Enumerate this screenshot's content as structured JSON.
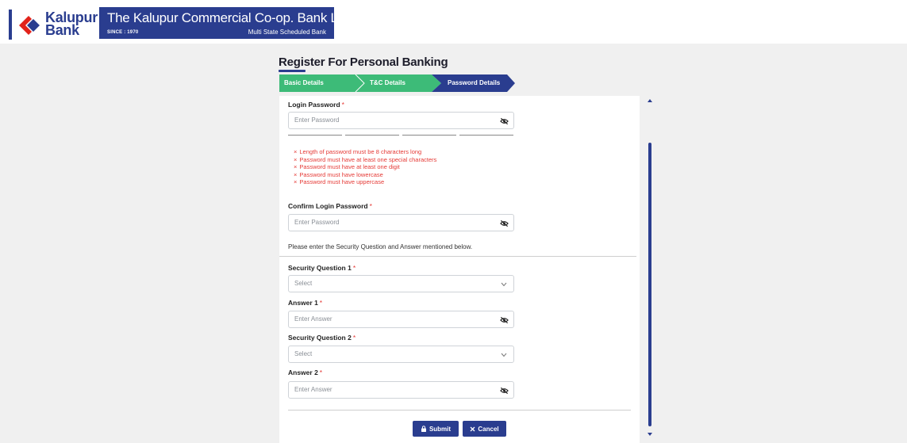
{
  "header": {
    "logo_name": "Kalupur\nBank",
    "logo_line1": "Kalupur",
    "logo_line2": "Bank",
    "bank_title": "The Kalupur Commercial Co-op. Bank Ltd.",
    "since": "SINCE : 1970",
    "tagline": "Multi State Scheduled Bank"
  },
  "page": {
    "heading": "Register For Personal Banking"
  },
  "stepper": {
    "steps": [
      {
        "label": "Basic Details",
        "state": "complete"
      },
      {
        "label": "T&C Details",
        "state": "complete"
      },
      {
        "label": "Password Details",
        "state": "active"
      }
    ]
  },
  "form": {
    "login_password": {
      "label": "Login Password",
      "required_mark": "*",
      "placeholder": "Enter Password"
    },
    "password_rules": [
      "Length of password must be 8 characters long",
      "Password must have at least one special characters",
      "Password must have at least one digit",
      "Password must have lowercase",
      "Password must have uppercase"
    ],
    "rule_mark": "×",
    "confirm_password": {
      "label": "Confirm Login Password",
      "required_mark": "*",
      "placeholder": "Enter Password"
    },
    "security_info": "Please enter the Security Question and Answer mentioned below.",
    "security_question_1": {
      "label": "Security Question 1",
      "required_mark": "*",
      "selected": "Select"
    },
    "answer_1": {
      "label": "Answer 1",
      "required_mark": "*",
      "placeholder": "Enter Answer"
    },
    "security_question_2": {
      "label": "Security Question 2",
      "required_mark": "*",
      "selected": "Select"
    },
    "answer_2": {
      "label": "Answer 2",
      "required_mark": "*",
      "placeholder": "Enter Answer"
    },
    "submit_label": "Submit",
    "cancel_label": "Cancel"
  },
  "colors": {
    "brand": "#2a3d8f",
    "step_complete": "#3dbb78",
    "error": "#e53935",
    "logo_red": "#e2231a"
  },
  "icons": {
    "eye": "eye-off-icon",
    "chevron": "chevron-down-icon",
    "lock": "lock-icon",
    "close": "close-icon"
  }
}
